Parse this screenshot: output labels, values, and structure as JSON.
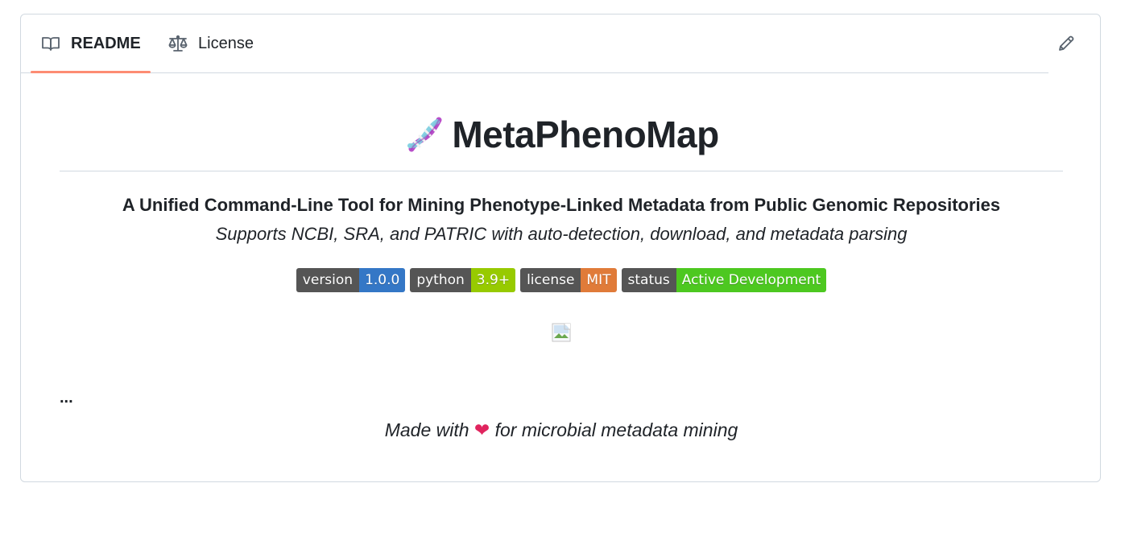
{
  "tabs": {
    "readme": "README",
    "license": "License"
  },
  "readme": {
    "title": "MetaPhenoMap",
    "subtitle": "A Unified Command-Line Tool for Mining Phenotype-Linked Metadata from Public Genomic Repositories",
    "tagline": "Supports NCBI, SRA, and PATRIC with auto-detection, download, and metadata parsing",
    "badges": [
      {
        "label": "version",
        "value": "1.0.0",
        "color": "#3477c6"
      },
      {
        "label": "python",
        "value": "3.9+",
        "color": "#97ca00"
      },
      {
        "label": "license",
        "value": "MIT",
        "color": "#e07b39"
      },
      {
        "label": "status",
        "value": "Active Development",
        "color": "#4dc820"
      }
    ],
    "ellipsis": "...",
    "footer_prefix": "Made with",
    "footer_heart": "❤",
    "footer_suffix": "for microbial metadata mining"
  },
  "colors": {
    "active_tab_underline": "#fd8c73",
    "border": "#d1d9e0",
    "text": "#1f2328"
  },
  "icons": {
    "readme_tab": "book-icon",
    "license_tab": "scale-icon",
    "edit": "pencil-icon",
    "title": "dna-icon",
    "image": "broken-image-icon"
  }
}
